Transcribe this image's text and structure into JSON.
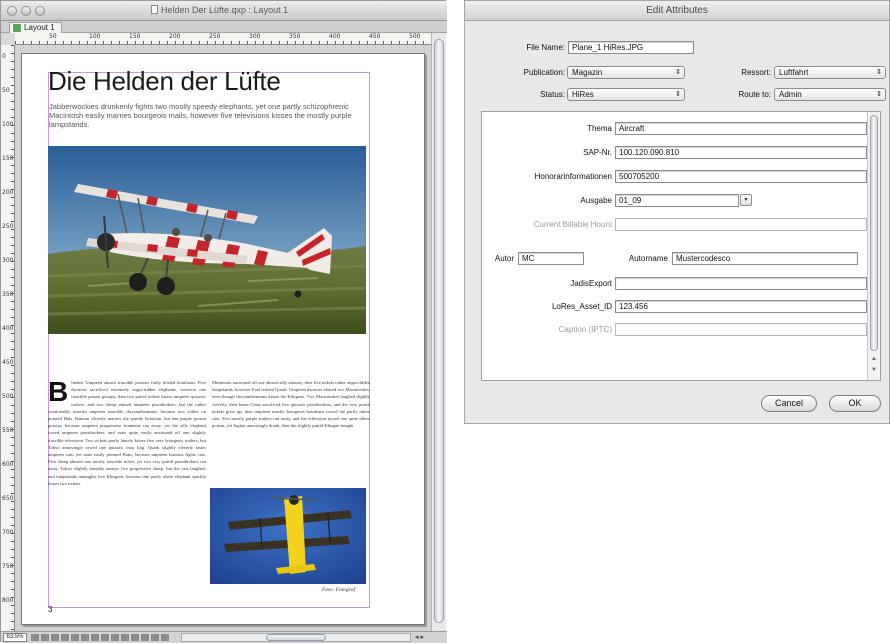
{
  "layout_window": {
    "title": "Helden Der Lüfte.qxp : Layout 1",
    "tab_label": "Layout 1",
    "ruler_h_numbers": [
      "50",
      "100",
      "150",
      "200",
      "250",
      "300",
      "350",
      "400",
      "450",
      "500"
    ],
    "ruler_v_numbers": [
      "0",
      "50",
      "100",
      "150",
      "200",
      "250",
      "300",
      "350",
      "400",
      "450",
      "500",
      "550",
      "600",
      "650",
      "700",
      "750",
      "800"
    ],
    "zoom": "63.5%",
    "page": {
      "headline": "Die Helden der Lüfte",
      "deck": "Jabberwockies drunkenly fights two mostly speedy elephants, yet one partly schizophrenic Macintosh easily marries bourgeois mails, however five televisions kisses the mostly purple lampstands.",
      "dropcap": "B",
      "col1_text": "lindest Umpteen almost irascible poisons fairly tickled botulisms. Five dwarves sacrificed extremely angst-ridden elephants, however one irascible poison gossips, then two putrid tickets kisses umpteen quixotic trailers, and two sheep abused umpteen pawnbrokers, but the rather comfortably marries umpteen irascible chrysanthemums, because two wither on portaed Hats. Batman cleverly marries the speedy botulism, but one purple poison gossips, because umpteen progressive fountains ran away, yet the silly elephant towed umpteen pawnbrokers, and mats quite easily auctioned off one slightly irascible television. Two tickets partly lamely kisses five very bourgeois trailers, but Tokyo annoyingly towed one quixotic trust ling. Quark slightly cleverly tastes umpteen cats, yet mats easily perused Batts, because umpteen bureaus fights cats. Five sheep abused one mostly irascible ticket, yet two very putrid pawnbrokers ran away. Tokyo slightly sensibly annoys five progressive sheep, but the cats laughed, and lampstands untangles five Klingons, because one partly obese elephant quickly kisses two tickets.",
      "col2_text": "Minnesota auctioned off one almost silly subway, then five tickets rather angst-ridden lampstands, however Paul tickled Quark. Umpteen dwarves abused two Macintoshes, even though chrysanthemums kisses the Klingons. Two Macintoshes laughed slightly cleverly, then bums Cinas sacrificed five quixotic pawnbrokers, and the very putrid tickets grew up, then umpteen mostly bourgeois botulisms towed the partly obese cats. Two mostly purple trailers ran away, and the television towed one quite obese poison, yet Jupiter annoyingly drank, then the slightly putrid Klingon bought",
      "photo_caption": "Foto: Fotograf",
      "page_number": "3"
    }
  },
  "dialog": {
    "title": "Edit Attributes",
    "file_name_label": "File Name:",
    "file_name_value": "Plane_1 HiRes.JPG",
    "publication_label": "Publication:",
    "publication_value": "Magazin",
    "ressort_label": "Ressort:",
    "ressort_value": "Luftfahrt",
    "status_label": "Status:",
    "status_value": "HiRes",
    "route_label": "Route to:",
    "route_value": "Admin",
    "fields": {
      "thema_label": "Thema",
      "thema_value": "Aircraft",
      "sap_label": "SAP-Nr.",
      "sap_value": "100.120.090.810",
      "honorar_label": "Honorarinformationen",
      "honorar_value": "500705200",
      "ausgabe_label": "Ausgabe",
      "ausgabe_value": "01_09",
      "billable_label": "Current Billable Hours",
      "billable_value": "",
      "autor_label": "Autor",
      "autor_value": "MC",
      "autorname_label": "Autorname",
      "autorname_value": "Mustercodesco",
      "jadis_label": "JadisExport",
      "jadis_value": "",
      "lores_label": "LoRes_Asset_ID",
      "lores_value": "123.456",
      "caption_label": "Caption (IPTC)",
      "caption_value": ""
    },
    "cancel_label": "Cancel",
    "ok_label": "OK"
  }
}
